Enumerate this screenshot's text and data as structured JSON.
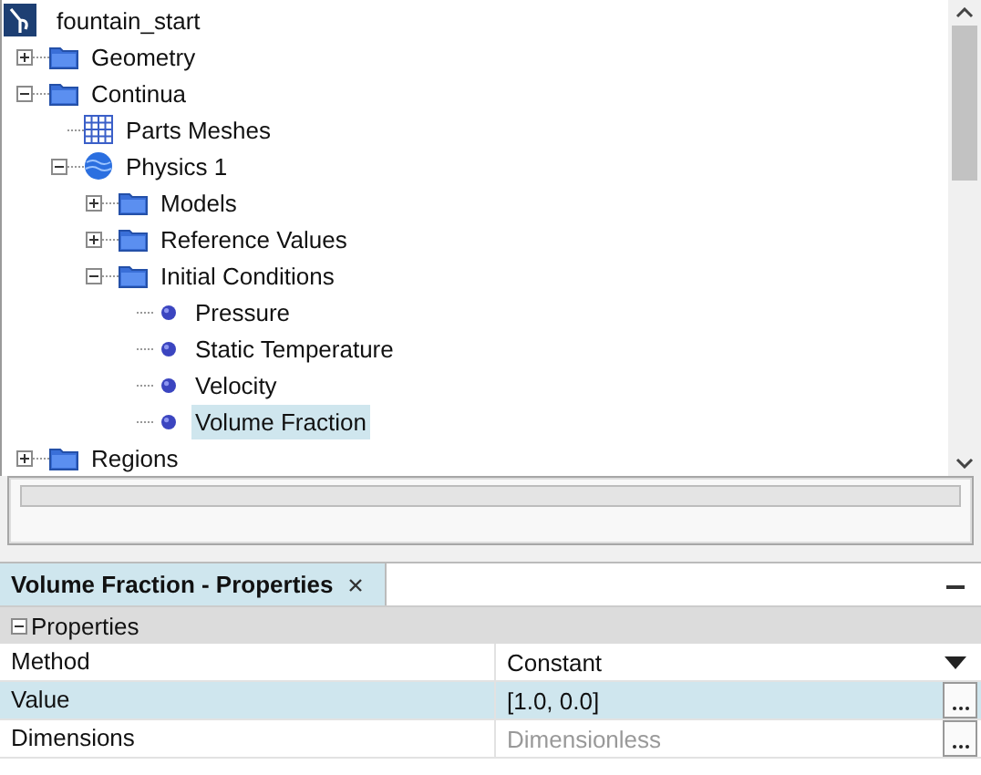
{
  "tree": {
    "root": {
      "label": "fountain_start"
    },
    "items": [
      {
        "label": "Geometry",
        "kind": "folder",
        "expanded": false,
        "selected": false
      },
      {
        "label": "Continua",
        "kind": "folder",
        "expanded": true,
        "selected": false,
        "children": [
          {
            "label": "Parts Meshes",
            "kind": "mesh",
            "selected": false
          },
          {
            "label": "Physics 1",
            "kind": "physics",
            "expanded": true,
            "selected": false,
            "children": [
              {
                "label": "Models",
                "kind": "folder",
                "expanded": false,
                "selected": false
              },
              {
                "label": "Reference Values",
                "kind": "folder",
                "expanded": false,
                "selected": false
              },
              {
                "label": "Initial Conditions",
                "kind": "folder",
                "expanded": true,
                "selected": false,
                "children": [
                  {
                    "label": "Pressure",
                    "kind": "condition",
                    "selected": false
                  },
                  {
                    "label": "Static Temperature",
                    "kind": "condition",
                    "selected": false
                  },
                  {
                    "label": "Velocity",
                    "kind": "condition",
                    "selected": false
                  },
                  {
                    "label": "Volume Fraction",
                    "kind": "condition",
                    "selected": true
                  }
                ]
              }
            ]
          }
        ]
      },
      {
        "label": "Regions",
        "kind": "folder",
        "expanded": false,
        "selected": false
      }
    ]
  },
  "properties": {
    "tab": {
      "title": "Volume Fraction - Properties"
    },
    "section": {
      "label": "Properties",
      "expanded": true
    },
    "rows": [
      {
        "name": "Method",
        "value": "Constant",
        "kind": "dropdown",
        "selected": false,
        "disabled": false
      },
      {
        "name": "Value",
        "value": "[1.0, 0.0]",
        "kind": "ellipsis",
        "selected": true,
        "disabled": false
      },
      {
        "name": "Dimensions",
        "value": "Dimensionless",
        "kind": "ellipsis",
        "selected": false,
        "disabled": true
      }
    ]
  }
}
